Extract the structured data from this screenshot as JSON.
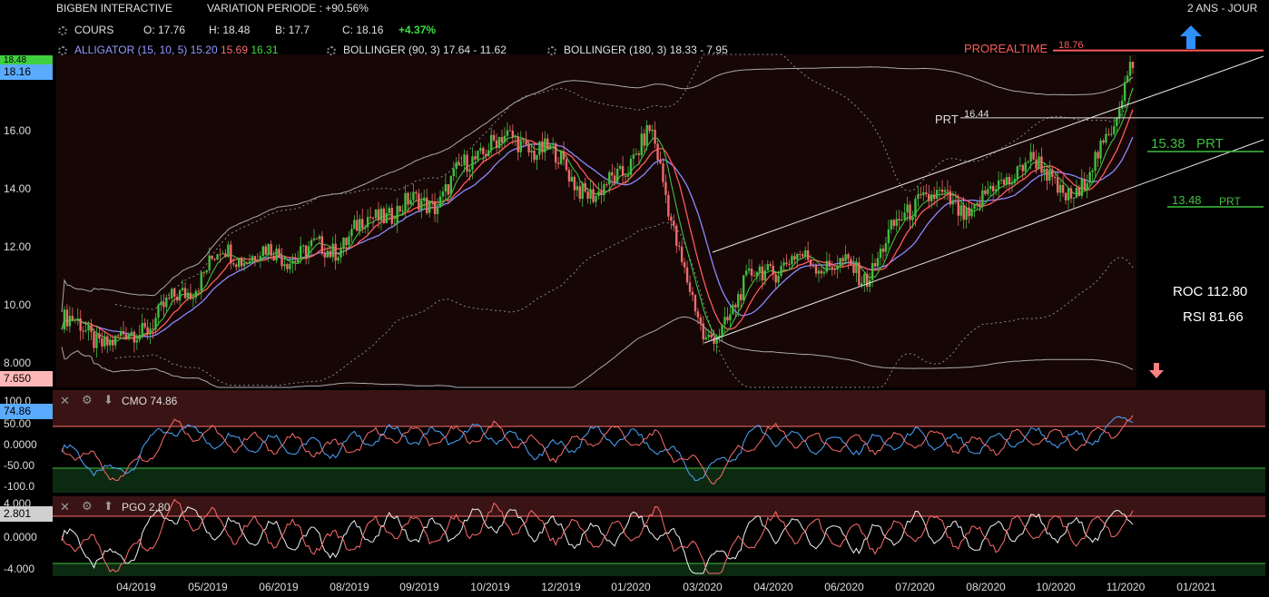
{
  "header": {
    "instrument": "BIGBEN INTERACTIVE",
    "variation": "VARIATION PERIODE : +90.56%",
    "period": "2 ANS - JOUR"
  },
  "cours": {
    "label": "COURS",
    "open": "O: 17.76",
    "high": "H: 18.48",
    "low": "B: 17.7",
    "close": "C: 18.16",
    "change": "+4.37%"
  },
  "indicators": {
    "alligator_label": "ALLIGATOR (15, 10, 5)",
    "alligator_v1": "15.20",
    "alligator_v2": "15.69",
    "alligator_v3": "16.31",
    "bollinger1": "BOLLINGER (90, 3) 17.64 - 11.62",
    "bollinger2": "BOLLINGER (180, 3) 18.33 - 7.95"
  },
  "levels": {
    "prorealtime_label": "PROREALTIME",
    "prorealtime_value": "18.76",
    "prt1_label": "PRT",
    "prt1_value": "16.44",
    "prt2_value": "15.38",
    "prt2_label": "PRT",
    "prt3_value": "13.48",
    "prt3_label": "PRT"
  },
  "stats": {
    "roc": "ROC 112.80",
    "rsi": "RSI 81.66"
  },
  "price_axis": {
    "ticks": [
      "16.00",
      "14.00",
      "12.00",
      "10.00",
      "8.000"
    ],
    "tag_top": "18.48",
    "tag_last": "18.16",
    "tag_low": "7.650"
  },
  "cmo": {
    "title": "CMO 74.86",
    "ticks": [
      "100.0",
      "50.00",
      "0.0000",
      "-50.00",
      "-100.0"
    ],
    "tag": "74.86"
  },
  "pgo": {
    "title": "PGO 2.80",
    "ticks": [
      "4.000",
      "0.0000",
      "-4.000"
    ],
    "tag": "2.801"
  },
  "x_axis": [
    "04/2019",
    "05/2019",
    "06/2019",
    "08/2019",
    "09/2019",
    "10/2019",
    "12/2019",
    "01/2020",
    "03/2020",
    "04/2020",
    "06/2020",
    "07/2020",
    "08/2020",
    "10/2020",
    "11/2020",
    "01/2021"
  ],
  "colors": {
    "up": "#3fbf3f",
    "down": "#ef6b6b",
    "jaw": "#8a8aff",
    "teeth": "#ff5a5a",
    "lips": "#3fbf3f",
    "resistance": "#ff5a5a",
    "support": "#3fbf3f"
  },
  "chart_data": {
    "type": "candlestick",
    "x": [
      "2019-03",
      "2019-04",
      "2019-05",
      "2019-06",
      "2019-07",
      "2019-08",
      "2019-09",
      "2019-10",
      "2019-11",
      "2019-12",
      "2020-01",
      "2020-02",
      "2020-03",
      "2020-04",
      "2020-05",
      "2020-06",
      "2020-07",
      "2020-08",
      "2020-09",
      "2020-10",
      "2020-11"
    ],
    "close": [
      9.5,
      8.6,
      9.9,
      11.8,
      11.7,
      11.9,
      13.2,
      13.6,
      15.7,
      15.4,
      13.6,
      15.9,
      8.5,
      11.2,
      11.6,
      11.0,
      13.8,
      13.2,
      15.0,
      13.6,
      18.16
    ],
    "ylim": [
      7.65,
      18.9
    ],
    "levels": {
      "PROREALTIME": 18.76,
      "PRT": [
        16.44,
        15.38,
        13.48
      ]
    },
    "cmo": {
      "title": "CMO 74.86",
      "ylim": [
        -100,
        100
      ],
      "values": [
        -10,
        -80,
        50,
        10,
        5,
        -10,
        30,
        20,
        35,
        -20,
        30,
        10,
        -80,
        35,
        5,
        0,
        20,
        -5,
        25,
        10,
        74.86
      ]
    },
    "pgo": {
      "title": "PGO 2.80",
      "ylim": [
        -4,
        4
      ],
      "values": [
        0,
        -3.5,
        3.5,
        1,
        0.5,
        -1,
        1.5,
        0.5,
        2.5,
        1,
        0,
        2,
        -4.5,
        1.5,
        0.5,
        -0.5,
        1.5,
        -0.5,
        1.5,
        0.5,
        2.8
      ]
    }
  }
}
